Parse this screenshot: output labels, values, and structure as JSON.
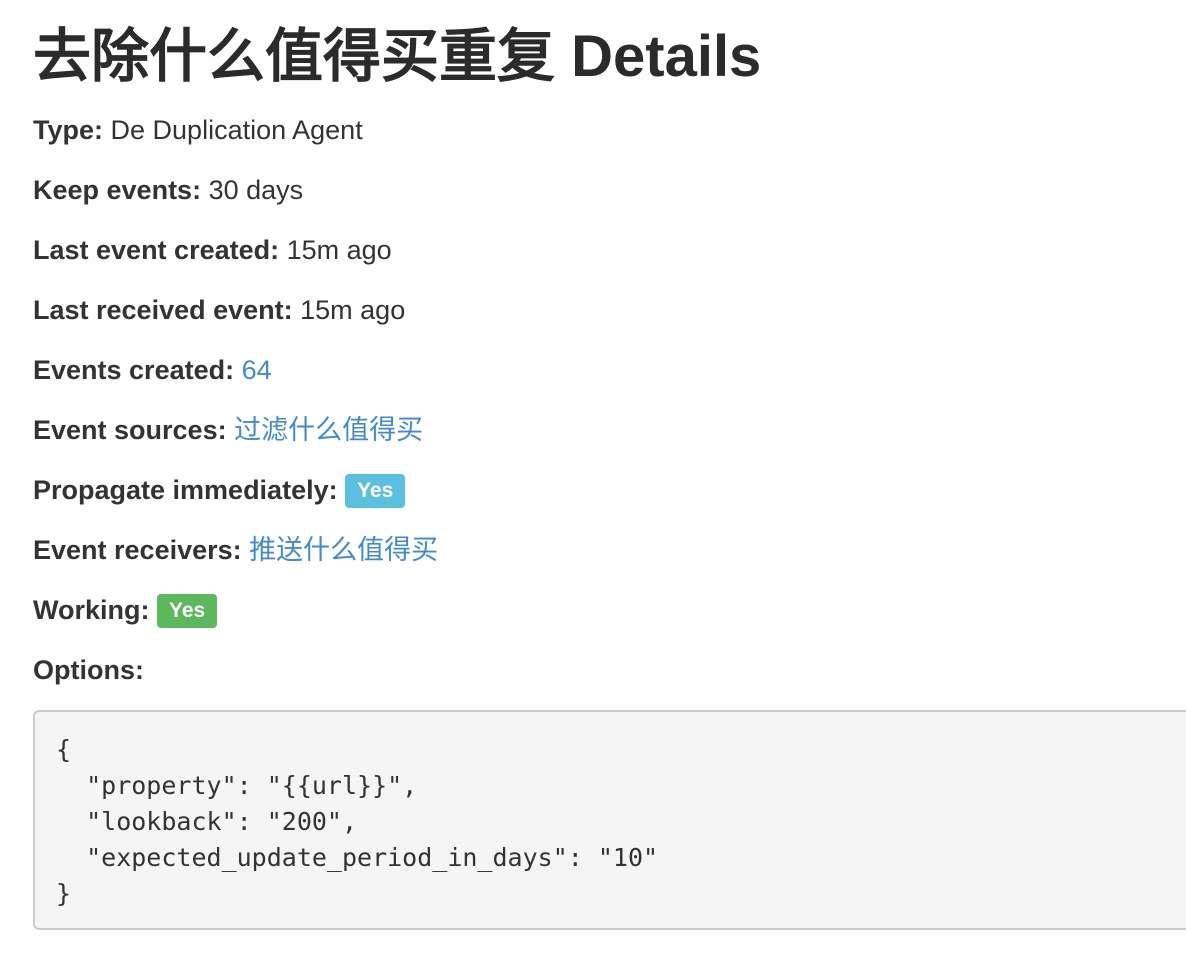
{
  "page": {
    "title": "去除什么值得买重复 Details"
  },
  "details": {
    "type": {
      "label": "Type:",
      "value": "De Duplication Agent"
    },
    "keep_events": {
      "label": "Keep events:",
      "value": "30 days"
    },
    "last_event_created": {
      "label": "Last event created:",
      "value": "15m ago"
    },
    "last_received_event": {
      "label": "Last received event:",
      "value": "15m ago"
    },
    "events_created": {
      "label": "Events created:",
      "value": "64"
    },
    "event_sources": {
      "label": "Event sources:",
      "value": "过滤什么值得买"
    },
    "propagate_immediately": {
      "label": "Propagate immediately:",
      "badge": "Yes",
      "badge_color": "#5bc0de"
    },
    "event_receivers": {
      "label": "Event receivers:",
      "value": "推送什么值得买"
    },
    "working": {
      "label": "Working:",
      "badge": "Yes",
      "badge_color": "#5cb85c"
    },
    "options": {
      "label": "Options:"
    }
  },
  "options_json": "{\n  \"property\": \"{{url}}\",\n  \"lookback\": \"200\",\n  \"expected_update_period_in_days\": \"10\"\n}",
  "colors": {
    "link": "#428bca",
    "text": "#333333",
    "code_background": "#f5f5f5"
  }
}
